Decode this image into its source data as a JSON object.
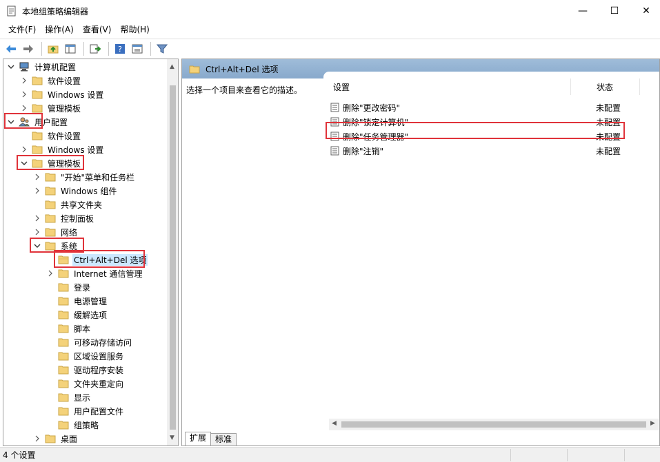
{
  "window": {
    "title": "本地组策略编辑器",
    "min_glyph": "—",
    "max_glyph": "☐",
    "close_glyph": "✕"
  },
  "menu": [
    "文件(F)",
    "操作(A)",
    "查看(V)",
    "帮助(H)"
  ],
  "toolbar": {
    "icons": [
      "back-arrow-icon",
      "forward-arrow-icon",
      "up-folder-icon",
      "show-hide-tree-icon",
      "export-list-icon",
      "help-icon",
      "properties-icon",
      "filter-icon"
    ]
  },
  "tree": [
    {
      "label": "计算机配置",
      "level": 0,
      "expander": "open",
      "icon": "computer-icon"
    },
    {
      "label": "软件设置",
      "level": 1,
      "expander": "closed",
      "icon": "folder-icon"
    },
    {
      "label": "Windows 设置",
      "level": 1,
      "expander": "closed",
      "icon": "folder-icon"
    },
    {
      "label": "管理模板",
      "level": 1,
      "expander": "closed",
      "icon": "folder-icon"
    },
    {
      "label": "用户配置",
      "level": 0,
      "expander": "open",
      "icon": "user-icon"
    },
    {
      "label": "软件设置",
      "level": 1,
      "expander": "none",
      "icon": "folder-icon"
    },
    {
      "label": "Windows 设置",
      "level": 1,
      "expander": "closed",
      "icon": "folder-icon"
    },
    {
      "label": "管理模板",
      "level": 1,
      "expander": "open",
      "icon": "folder-icon"
    },
    {
      "label": "\"开始\"菜单和任务栏",
      "level": 2,
      "expander": "closed",
      "icon": "folder-icon"
    },
    {
      "label": "Windows 组件",
      "level": 2,
      "expander": "closed",
      "icon": "folder-icon"
    },
    {
      "label": "共享文件夹",
      "level": 2,
      "expander": "none",
      "icon": "folder-icon"
    },
    {
      "label": "控制面板",
      "level": 2,
      "expander": "closed",
      "icon": "folder-icon"
    },
    {
      "label": "网络",
      "level": 2,
      "expander": "closed",
      "icon": "folder-icon"
    },
    {
      "label": "系统",
      "level": 2,
      "expander": "open",
      "icon": "folder-icon"
    },
    {
      "label": "Ctrl+Alt+Del 选项",
      "level": 3,
      "expander": "none",
      "icon": "folder-open-icon",
      "selected": true
    },
    {
      "label": "Internet 通信管理",
      "level": 3,
      "expander": "closed",
      "icon": "folder-icon"
    },
    {
      "label": "登录",
      "level": 3,
      "expander": "none",
      "icon": "folder-icon"
    },
    {
      "label": "电源管理",
      "level": 3,
      "expander": "none",
      "icon": "folder-icon"
    },
    {
      "label": "缓解选项",
      "level": 3,
      "expander": "none",
      "icon": "folder-icon"
    },
    {
      "label": "脚本",
      "level": 3,
      "expander": "none",
      "icon": "folder-icon"
    },
    {
      "label": "可移动存储访问",
      "level": 3,
      "expander": "none",
      "icon": "folder-icon"
    },
    {
      "label": "区域设置服务",
      "level": 3,
      "expander": "none",
      "icon": "folder-icon"
    },
    {
      "label": "驱动程序安装",
      "level": 3,
      "expander": "none",
      "icon": "folder-icon"
    },
    {
      "label": "文件夹重定向",
      "level": 3,
      "expander": "none",
      "icon": "folder-icon"
    },
    {
      "label": "显示",
      "level": 3,
      "expander": "none",
      "icon": "folder-icon"
    },
    {
      "label": "用户配置文件",
      "level": 3,
      "expander": "none",
      "icon": "folder-icon"
    },
    {
      "label": "组策略",
      "level": 3,
      "expander": "none",
      "icon": "folder-icon"
    },
    {
      "label": "桌面",
      "level": 2,
      "expander": "closed",
      "icon": "folder-icon"
    }
  ],
  "right": {
    "header_title": "Ctrl+Alt+Del 选项",
    "description": "选择一个项目来查看它的描述。",
    "col_setting": "设置",
    "col_state": "状态",
    "rows": [
      {
        "name": "删除\"更改密码\"",
        "state": "未配置"
      },
      {
        "name": "删除\"锁定计算机\"",
        "state": "未配置"
      },
      {
        "name": "删除\"任务管理器\"",
        "state": "未配置"
      },
      {
        "name": "删除\"注销\"",
        "state": "未配置"
      }
    ],
    "tabs": [
      "扩展",
      "标准"
    ]
  },
  "status": {
    "text": "4 个设置"
  },
  "colors": {
    "highlight": "#e0333a",
    "header": "#9fbcd9",
    "folder": "#f4d27a"
  }
}
